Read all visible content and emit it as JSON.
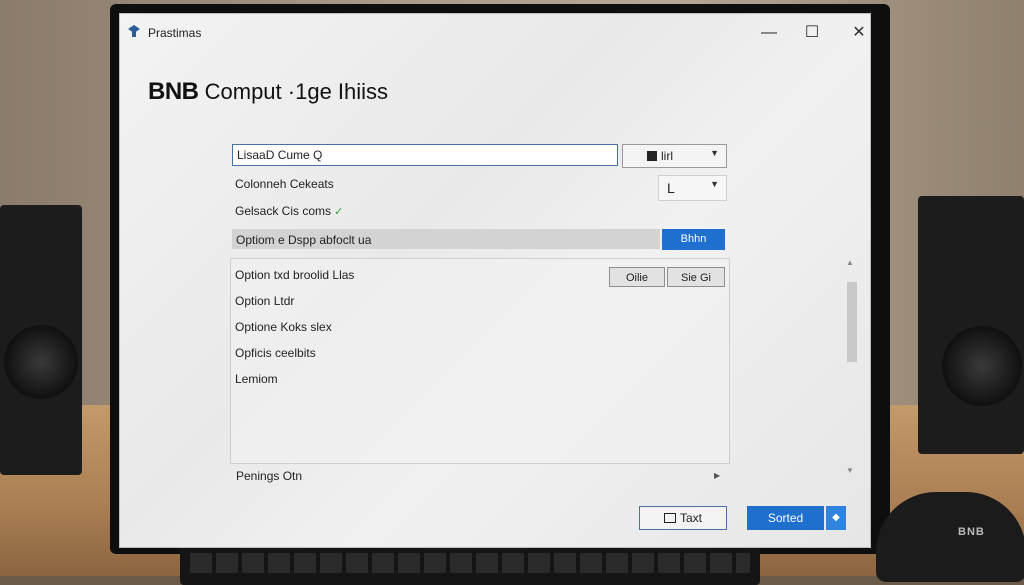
{
  "window": {
    "title": "Prastimas",
    "controls": {
      "minimize": "—",
      "maximize": "☐",
      "close": "✕"
    }
  },
  "header": {
    "brand": "BNB",
    "title": "Comput ·1ge Ihiiss"
  },
  "form": {
    "main_input_value": "LisaaD Cume Q",
    "combo1_label": "lirl",
    "combo2_label": "L",
    "label1": "Colonneh Cekeats",
    "label2": "Gelsack Cis coms",
    "label2_check": "✓",
    "select_label": "Optiom e Dspp abfoclt ua",
    "select_button": "Bhhn"
  },
  "options": {
    "button1": "Oilie",
    "button2": "Sie Gi",
    "items": [
      "Option txd broolid Llas",
      "Option Ltdr",
      "Optione Koks slex",
      "Opficis ceelbits",
      "Lemiom"
    ]
  },
  "footer": {
    "label": "Penings Otn",
    "text_button": "Taxt",
    "primary_button": "Sorted"
  },
  "monitor_brand": "BNB",
  "colors": {
    "accent": "#1e6fce",
    "focus_border": "#4a6fa5",
    "check": "#2f9b3a"
  }
}
